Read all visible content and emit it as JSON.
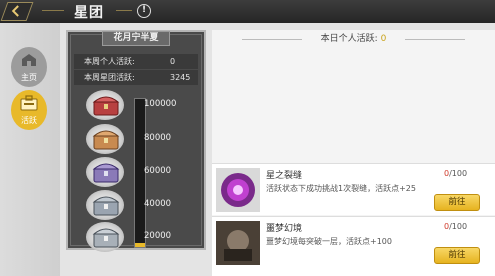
{
  "header": {
    "title": "星团"
  },
  "nav": {
    "items": [
      {
        "label": "主页"
      },
      {
        "label": "活跃"
      }
    ]
  },
  "left_panel": {
    "header": "花月宁半夏",
    "personal_weekly_label": "本周个人活跃:",
    "personal_weekly_value": "0",
    "cluster_weekly_label": "本周星团活跃:",
    "cluster_weekly_value": "3245",
    "milestones": [
      "100000",
      "80000",
      "60000",
      "40000",
      "20000"
    ],
    "progress_fraction": 0.03
  },
  "right_panel": {
    "header_label": "本日个人活跃:",
    "header_value": "0",
    "tasks": [
      {
        "title": "星之裂缝",
        "description": "活跃状态下成功挑战1次裂缝，活跃点+25",
        "progress_current": "0",
        "progress_total": "/100",
        "button": "前往"
      },
      {
        "title": "噩梦幻境",
        "description": "噩梦幻境每突破一层，活跃点+100",
        "progress_current": "0",
        "progress_total": "/100",
        "button": "前往"
      }
    ]
  },
  "colors": {
    "accent": "#e8b92a",
    "progress_red": "#d03a2a"
  }
}
